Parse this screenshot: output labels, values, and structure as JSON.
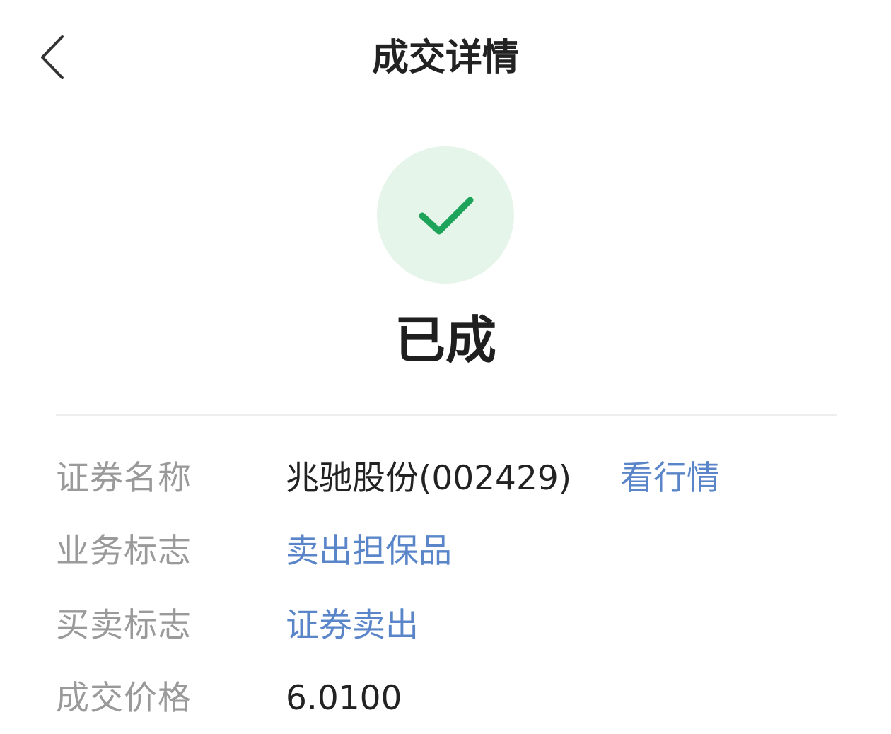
{
  "header": {
    "title": "成交详情",
    "back_icon": "chevron-left-icon"
  },
  "status": {
    "icon": "check-icon",
    "text": "已成",
    "icon_color": "#1ea35a",
    "circle_color": "#e6f5ea"
  },
  "details": {
    "security_name": {
      "label": "证券名称",
      "value": "兆驰股份(002429)",
      "quote_link": "看行情"
    },
    "business_flag": {
      "label": "业务标志",
      "value": "卖出担保品"
    },
    "trade_flag": {
      "label": "买卖标志",
      "value": "证券卖出"
    },
    "price": {
      "label": "成交价格",
      "value": "6.0100"
    }
  },
  "colors": {
    "link": "#5a86c9",
    "label": "#9a9a9a",
    "text": "#222222"
  }
}
